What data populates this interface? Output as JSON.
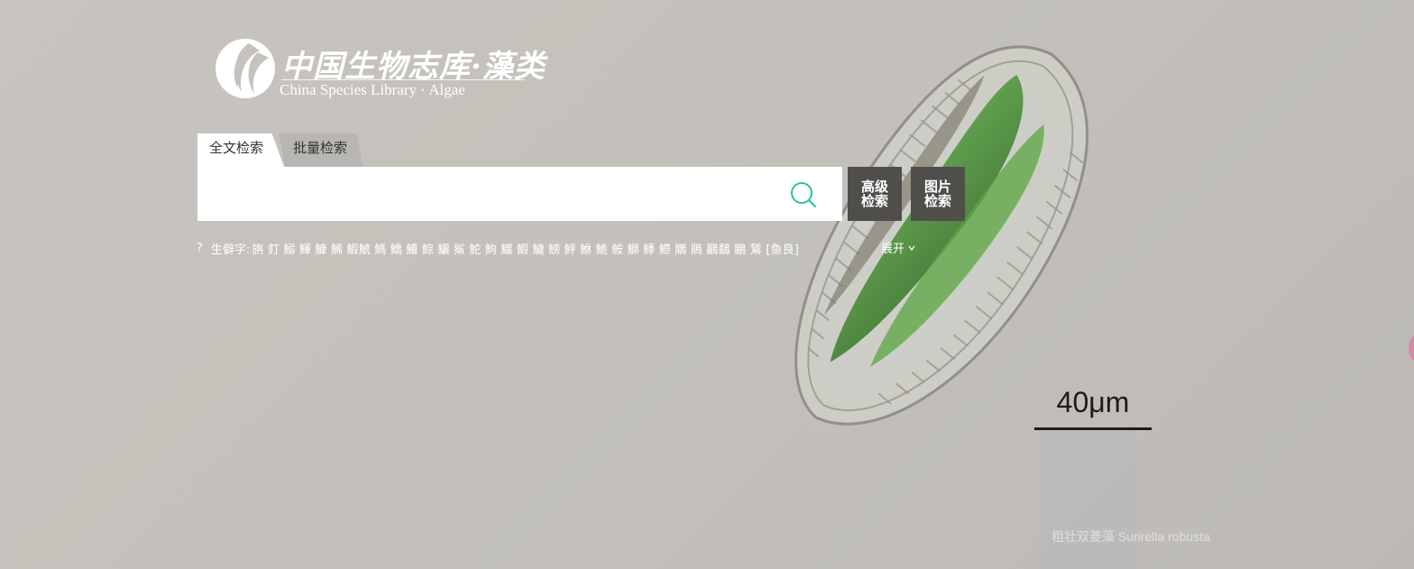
{
  "logo": {
    "title_cn": "中国生物志库·藻类",
    "title_en": "China Species Library · Algae"
  },
  "tabs": [
    {
      "label": "全文检索",
      "active": true
    },
    {
      "label": "批量检索",
      "active": false
    }
  ],
  "search": {
    "value": "",
    "placeholder": "",
    "icon": "search-icon",
    "accent_color": "#2bbf9e"
  },
  "buttons": {
    "advanced_line1": "高级",
    "advanced_line2": "检索",
    "image_line1": "图片",
    "image_line2": "检索"
  },
  "rare_chars": {
    "help": "?",
    "label": "生僻字:",
    "chars": "旃 釘 鰯 鯶 鱇 鯑 鰕鯱 鰢 鱎 鱶 鯮 鱺 鯊 鮀 鮈 鱷 鰕 鱥 鰟 鮃 鮴 鮠 鮟 鰤 鯚 鰶 鷴 鵙 鸝鷸 鵬 鵟 [鱼良]",
    "expand": "展开"
  },
  "background": {
    "scale_label": "40μm",
    "caption": "粗壮双菱藻 Surirella robusta"
  }
}
